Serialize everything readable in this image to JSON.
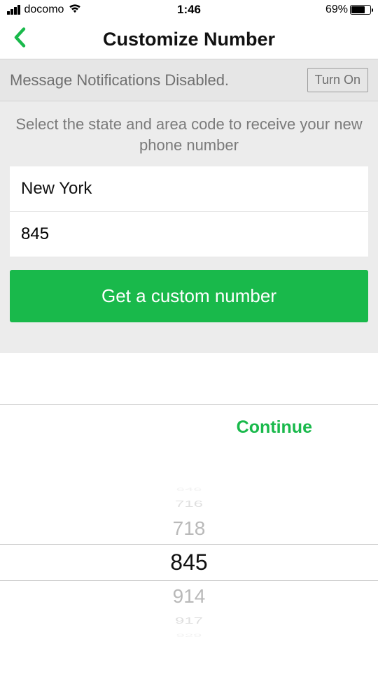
{
  "status": {
    "carrier": "docomo",
    "time": "1:46",
    "battery_pct": "69%"
  },
  "nav": {
    "title": "Customize Number"
  },
  "banner": {
    "message": "Message Notifications Disabled.",
    "action": "Turn On"
  },
  "form": {
    "instructions": "Select the state and area code to receive your new phone number",
    "state_value": "New York",
    "code_value": "845",
    "submit_label": "Get a custom number"
  },
  "picker": {
    "continue_label": "Continue",
    "items": [
      "646",
      "716",
      "718",
      "845",
      "914",
      "917",
      "929"
    ],
    "selected_index": 3
  }
}
